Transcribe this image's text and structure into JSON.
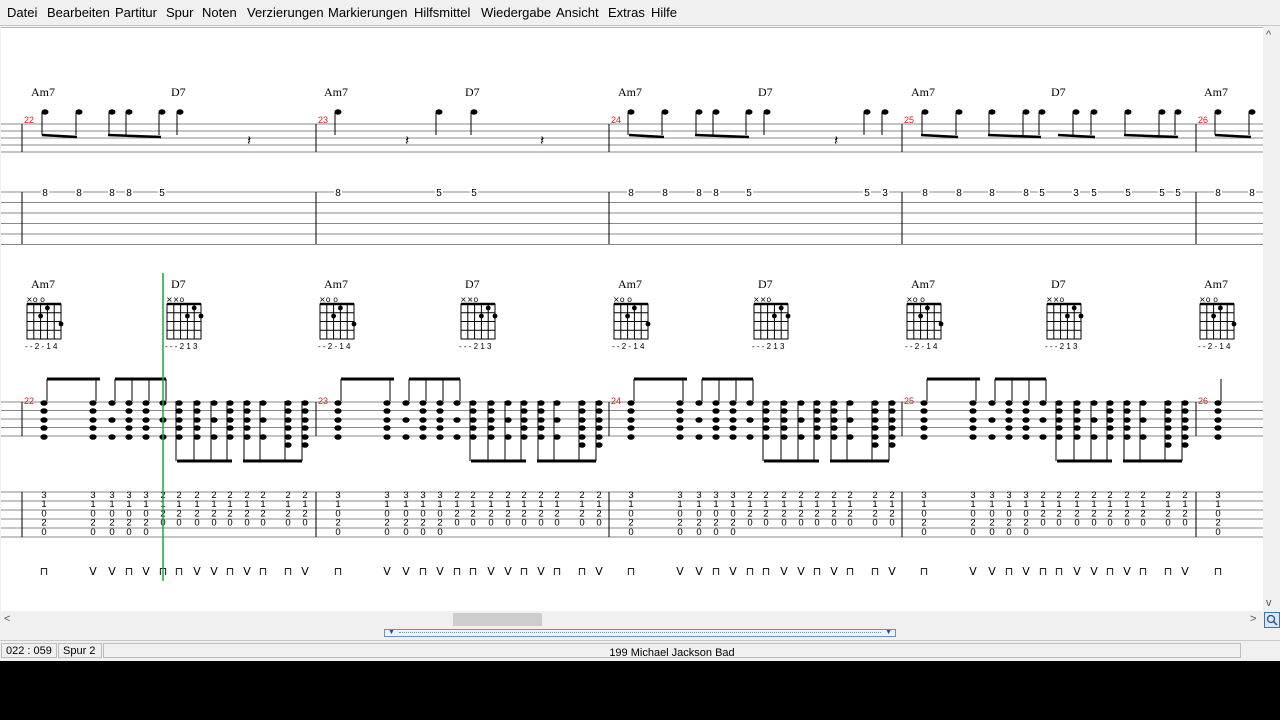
{
  "menu": [
    "Datei",
    "Bearbeiten",
    "Partitur",
    "Spur",
    "Noten",
    "Verzierungen",
    "Markierungen",
    "Hilfsmittel",
    "Wiedergabe",
    "Ansicht",
    "Extras",
    "Hilfe"
  ],
  "score": {
    "measures": [
      {
        "number": "22",
        "chords": [
          "Am7",
          "D7"
        ]
      },
      {
        "number": "23",
        "chords": [
          "Am7",
          "D7"
        ]
      },
      {
        "number": "24",
        "chords": [
          "Am7",
          "D7"
        ]
      },
      {
        "number": "25",
        "chords": [
          "Am7",
          "D7"
        ]
      },
      {
        "number": "26",
        "chords": [
          "Am7"
        ]
      }
    ],
    "chord_diagrams": {
      "Am7": {
        "top": "×o  o",
        "fingering": "- - 2 - 1 4"
      },
      "D7": {
        "top": "××o",
        "fingering": "- - - 2 1 3"
      }
    },
    "top_tab_numbers": [
      [
        "8",
        "8",
        "8",
        "8",
        "5"
      ],
      [
        "8",
        "5",
        "5"
      ],
      [
        "8",
        "8",
        "8",
        "8",
        "5",
        "5",
        "3"
      ],
      [
        "8",
        "8",
        "8",
        "8",
        "5",
        "3",
        "5",
        "5",
        "5",
        "5"
      ],
      [
        "8",
        "8"
      ]
    ],
    "rhythm_tab_pattern": {
      "am7": [
        "3",
        "1",
        "0",
        "2",
        "0"
      ],
      "d7": [
        "2",
        "1",
        "2",
        "0"
      ]
    },
    "strum_symbols": {
      "up": "V",
      "down": "⊓"
    }
  },
  "status": {
    "position": "022 : 059",
    "track": "Spur 2",
    "song": "199  Michael Jackson   Bad"
  },
  "colors": {
    "measure_number": "#d02020",
    "cursor": "#1fa83a"
  }
}
